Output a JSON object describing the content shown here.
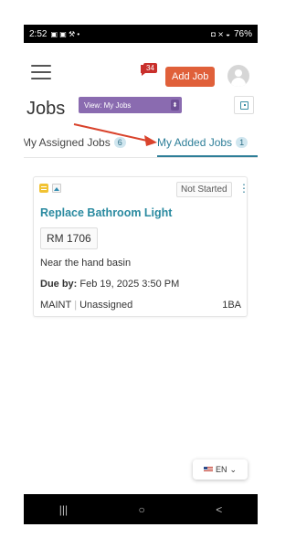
{
  "status_bar": {
    "time": "2:52",
    "left_icons": "▣ ▣ ⚒ •",
    "right_icons": "◘ ⨯ ◒",
    "battery": "76%"
  },
  "header": {
    "notification_count": "34",
    "add_job_label": "Add Job"
  },
  "page": {
    "title": "Jobs",
    "view_select": "View: My Jobs",
    "view_caret": "⬍"
  },
  "tabs": [
    {
      "label": "My Assigned Jobs",
      "count": "6"
    },
    {
      "label": "My Added Jobs",
      "count": "1"
    }
  ],
  "job_card": {
    "status": "Not Started",
    "kebab": "⋮",
    "title": "Replace Bathroom Light",
    "room": "RM 1706",
    "description": "Near the hand basin",
    "due_label": "Due by:",
    "due_value": "Feb 19, 2025 3:50 PM",
    "department": "MAINT",
    "assignee": "Unassigned",
    "code": "1BA"
  },
  "language": {
    "label": "EN",
    "chevron": "⌄"
  },
  "nav": {
    "recents": "|||",
    "home": "○",
    "back": "<"
  },
  "colors": {
    "accent": "#2d7e98",
    "add_job": "#e0603a",
    "view_select": "#8a6bb0",
    "arrow": "#d9432c"
  }
}
